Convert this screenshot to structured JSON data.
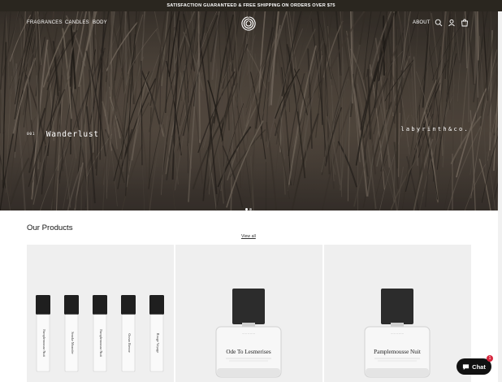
{
  "announcement": {
    "text": "SATISFACTION GUARANTEED & FREE SHIPPING ON ORDERS OVER $75"
  },
  "nav": {
    "left": [
      "FRAGRANCES",
      "CANDLES",
      "BODY"
    ],
    "right": [
      "ABOUT"
    ],
    "icons": [
      "search-icon",
      "account-icon",
      "cart-icon"
    ]
  },
  "hero": {
    "slide_number": "001",
    "slide_title": "Wanderlust",
    "brand_text": "labyrinth&co.",
    "slide_count": 2,
    "active_slide": 1
  },
  "products_section": {
    "title": "Our Products",
    "view_all": "View all"
  },
  "products": [
    {
      "type": "sampler",
      "vial_labels": [
        "Pamplemousse Nuit",
        "Smoke Meander",
        "Pamplemousse Nuit",
        "Ocean Breeze",
        "Rouge Voyage"
      ]
    },
    {
      "type": "bottle",
      "label": "Ode To Lesmerises"
    },
    {
      "type": "bottle",
      "label": "Pamplemousse Nuit"
    }
  ],
  "chat": {
    "label": "Chat",
    "badge": "1"
  },
  "colors": {
    "announcement_bg": "#2a261f",
    "card_bg": "#efefef",
    "chat_bg": "#111111",
    "badge": "#d7263d"
  }
}
